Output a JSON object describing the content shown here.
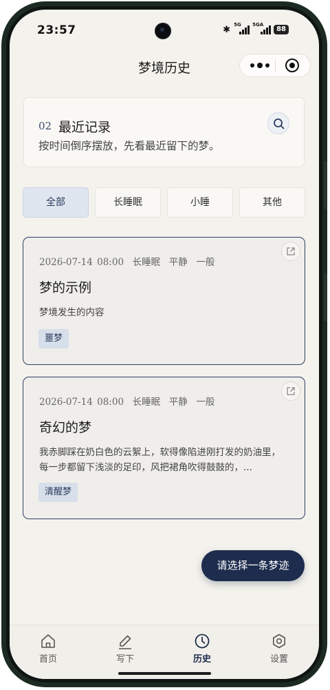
{
  "status_bar": {
    "time": "23:57",
    "signal1": "5G",
    "signal2": "5GA",
    "battery": "88"
  },
  "nav": {
    "title": "梦境历史"
  },
  "header": {
    "number": "02",
    "title": "最近记录",
    "subtitle": "按时间倒序摆放，先看最近留下的梦。"
  },
  "filters": [
    {
      "label": "全部",
      "active": true
    },
    {
      "label": "长睡眠",
      "active": false
    },
    {
      "label": "小睡",
      "active": false
    },
    {
      "label": "其他",
      "active": false
    }
  ],
  "dreams": [
    {
      "date": "2026-07-14 08:00",
      "sleep_type": "长睡眠",
      "mood": "平静",
      "clarity": "一般",
      "title": "梦的示例",
      "content": "梦境发生的内容",
      "tag": "噩梦"
    },
    {
      "date": "2026-07-14 08:00",
      "sleep_type": "长睡眠",
      "mood": "平静",
      "clarity": "一般",
      "title": "奇幻的梦",
      "content": "我赤脚踩在奶白色的云絮上，软得像陷进刚打发的奶油里，每一步都留下浅淡的足印，风把裙角吹得鼓鼓的，...",
      "tag": "清醒梦"
    }
  ],
  "fab": {
    "label": "请选择一条梦迹"
  },
  "tabs": [
    {
      "label": "首页",
      "icon": "home-icon",
      "active": false
    },
    {
      "label": "写下",
      "icon": "pen-icon",
      "active": false
    },
    {
      "label": "历史",
      "icon": "clock-icon",
      "active": true
    },
    {
      "label": "设置",
      "icon": "gear-icon",
      "active": false
    }
  ],
  "colors": {
    "accent": "#1e2d4e",
    "background": "#f4f2ec",
    "tag_background": "#d6dfea"
  }
}
